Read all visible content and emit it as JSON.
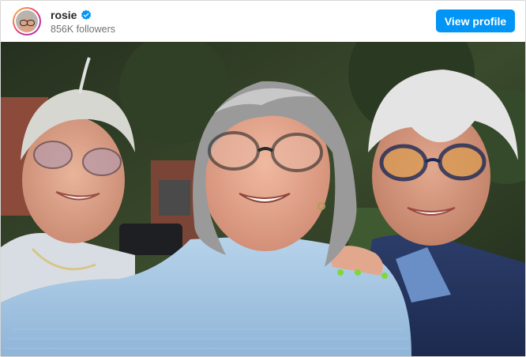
{
  "post": {
    "username": "rosie",
    "verified": true,
    "followers": "856K followers",
    "view_profile_label": "View profile"
  },
  "icons": {
    "verified": "verified-badge-icon",
    "avatar": "profile-avatar"
  },
  "colors": {
    "accent": "#0095f6",
    "username": "#262626",
    "secondary_text": "#737373",
    "verified": "#0095f6"
  },
  "media": {
    "type": "photo",
    "alt": "Selfie of three smiling women with short gray hair and glasses outdoors"
  }
}
